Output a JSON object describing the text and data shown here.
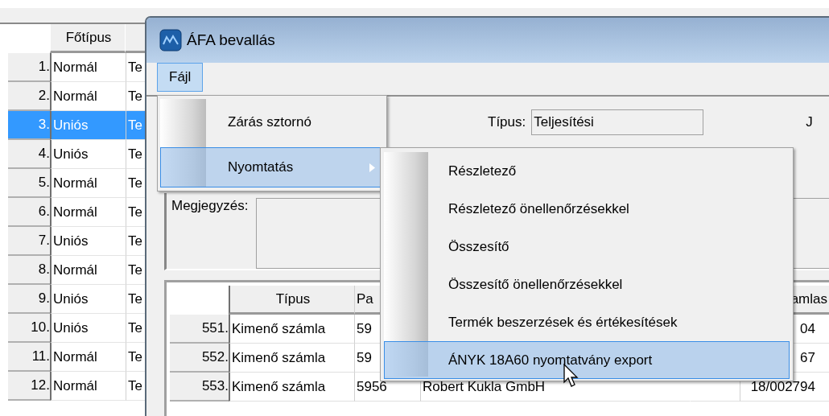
{
  "background_grid": {
    "header": "Főtípus",
    "rows": [
      {
        "number": "1.",
        "type": "Normál",
        "column_3": "Te",
        "selected": false
      },
      {
        "number": "2.",
        "type": "Normál",
        "column_3": "Te",
        "selected": false
      },
      {
        "number": "3.",
        "type": "Uniós",
        "column_3": "Te",
        "selected": true
      },
      {
        "number": "4.",
        "type": "Uniós",
        "column_3": "Te",
        "selected": false
      },
      {
        "number": "5.",
        "type": "Normál",
        "column_3": "Te",
        "selected": false
      },
      {
        "number": "6.",
        "type": "Normál",
        "column_3": "Te",
        "selected": false
      },
      {
        "number": "7.",
        "type": "Uniós",
        "column_3": "Te",
        "selected": false
      },
      {
        "number": "8.",
        "type": "Normál",
        "column_3": "Te",
        "selected": false
      },
      {
        "number": "9.",
        "type": "Uniós",
        "column_3": "Te",
        "selected": false
      },
      {
        "number": "10.",
        "type": "Uniós",
        "column_3": "Te",
        "selected": false
      },
      {
        "number": "11.",
        "type": "Normál",
        "column_3": "Te",
        "selected": false
      },
      {
        "number": "12.",
        "type": "Normál",
        "column_3": "Te",
        "selected": false
      }
    ]
  },
  "dialog": {
    "title": "ÁFA bevallás",
    "menu": [
      {
        "label": "Fájl",
        "selected": true
      }
    ],
    "form": {
      "type_label": "Típus:",
      "type_value": "Teljesítési",
      "cut_label": "J",
      "note_label": "Megjegyzés:"
    },
    "grid": {
      "header": {
        "column_1": "Típus",
        "column_2": "Pa",
        "column_5": "amlas"
      },
      "rows": [
        {
          "number": "551.",
          "column_1": "Kimenő számla",
          "column_2": "59",
          "column_5": "04"
        },
        {
          "number": "552.",
          "column_1": "Kimenő számla",
          "column_2": "59",
          "column_5": "67"
        },
        {
          "number": "553.",
          "column_1": "Kimenő számla",
          "column_2": "5956",
          "column_3": "Robert Kukla GmbH",
          "column_5": "18/002794"
        }
      ]
    }
  },
  "file_menu": [
    {
      "label": "Zárás sztornó",
      "selected": false,
      "submenu": false
    },
    {
      "label": "Nyomtatás",
      "selected": true,
      "submenu": true
    }
  ],
  "print_submenu": [
    {
      "label": "Részletező",
      "selected": false
    },
    {
      "label": "Részletező önellenőrzésekkel",
      "selected": false
    },
    {
      "label": "Összesítő",
      "selected": false
    },
    {
      "label": "Összesítő önellenőrzésekkel",
      "selected": false
    },
    {
      "label": "Termék beszerzések és értékesítések",
      "selected": false
    },
    {
      "label": "ÁNYK 18A60 nyomtatvány export",
      "selected": true
    }
  ]
}
